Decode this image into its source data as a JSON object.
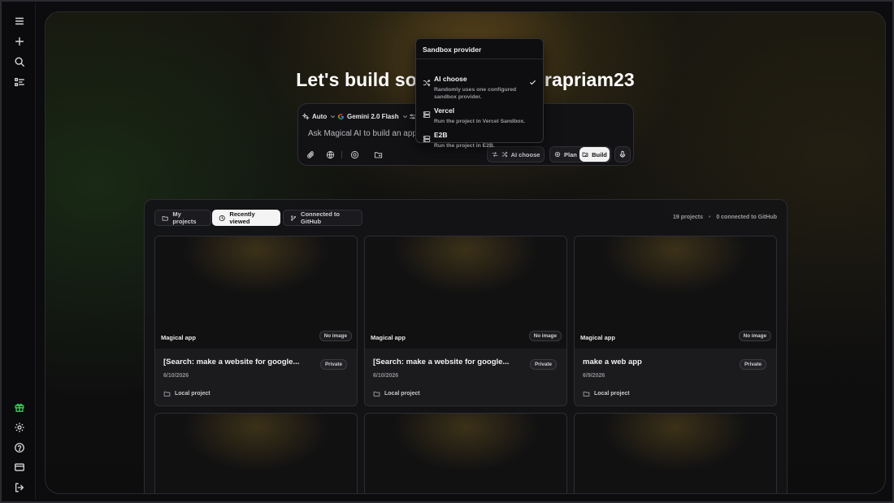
{
  "sidebar": {
    "top_icons": [
      "menu-icon",
      "plus-icon",
      "search-icon",
      "checklist-icon"
    ],
    "bottom_icons": [
      "gift-icon",
      "gear-icon",
      "help-icon",
      "billing-icon",
      "logout-icon"
    ],
    "gift_color": "#3ecf5a"
  },
  "headline": "Let's build so",
  "headline_tail": "rapriam23",
  "prompt": {
    "mode_label": "Auto",
    "model_label": "Gemini 2.0 Flash",
    "placeholder": "Ask Magical AI to build an app",
    "sandbox_pill": "AI choose",
    "plan_label": "Plan",
    "build_label": "Build"
  },
  "dropdown": {
    "title": "Sandbox provider",
    "items": [
      {
        "label": "AI choose",
        "desc": "Randomly uses one configured sandbox provider.",
        "icon": "shuffle-icon",
        "selected": true
      },
      {
        "label": "Vercel",
        "desc": "Run the project in Vercel Sandbox.",
        "icon": "server-icon",
        "selected": false
      },
      {
        "label": "E2B",
        "desc": "Run the project in E2B.",
        "icon": "server-icon",
        "selected": false
      }
    ]
  },
  "projects": {
    "tabs": [
      "My projects",
      "Recently viewed",
      "Connected to GitHub"
    ],
    "active_tab": "Recently viewed",
    "count_text": "19 projects",
    "github_text": "0 connected to GitHub",
    "cards": [
      {
        "thumb_label": "Magical app",
        "badge": "No image",
        "title": "[Search: make a website for google...",
        "visibility": "Private",
        "date": "6/10/2026",
        "location": "Local project"
      },
      {
        "thumb_label": "Magical app",
        "badge": "No image",
        "title": "[Search: make a website for google...",
        "visibility": "Private",
        "date": "6/10/2026",
        "location": "Local project"
      },
      {
        "thumb_label": "Magical app",
        "badge": "No image",
        "title": "make a web app",
        "visibility": "Private",
        "date": "6/9/2026",
        "location": "Local project"
      }
    ]
  }
}
